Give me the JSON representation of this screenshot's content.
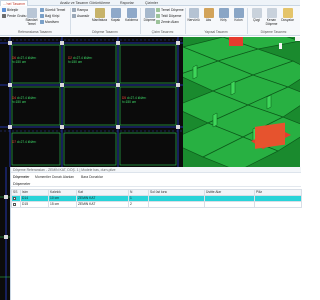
{
  "ribbon": {
    "tabs": [
      "...'nel Tasarım",
      "Analiz ve Tasarım Görüntüleme",
      "Raporlar",
      "Çizimler"
    ],
    "item_labels": [
      "Birleştir",
      "Perde Grubu",
      "Standart Temel",
      "Sürekli Temel",
      "Bağ Kirişi",
      "Mardiven",
      "Rampa",
      "Asansör",
      "Manifatura",
      "Kapak",
      "Kaldırma",
      "Döşeme",
      "Temel Döşeme",
      "Tekil Döşeme",
      "Zemin Alanı",
      "Nervürlü",
      "Aks",
      "Kiriş",
      "Kolon",
      "Çizgi",
      "Kenarı Döşeme",
      "Dosyalar",
      "Referansmane Bağlantı"
    ],
    "group_labels": [
      "Referanslama Tasarımı",
      "Döşeme Tasarımı",
      "Çizim Tasarımı",
      "Yapısal Tasarım",
      "Döşeme Tasarımı"
    ]
  },
  "plan": {
    "tags": [
      {
        "id": "D6",
        "line1": "d=27.4 kN/m²",
        "line2": "h=150 cm",
        "line3": "Ld=4.2"
      },
      {
        "id": "D2",
        "line1": "d=27.4 kN/m²",
        "line2": "h=150 cm",
        "line3": "Ld=4.2"
      },
      {
        "id": "D4",
        "line1": "d=27.4 kN/m²",
        "line2": "h=150 cm",
        "line3": ""
      },
      {
        "id": "D5",
        "line1": "d=27.4 kN/m²",
        "line2": "h=150 cm",
        "line3": ""
      },
      {
        "id": "D7",
        "line1": "d=27.4 kN/m²",
        "line2": "",
        "line3": ""
      }
    ]
  },
  "panel": {
    "title": "Döşeme Referansları - ZEMİN KAT, DÖŞ. 1 | Modele bas, durn-pilze",
    "tabs": [
      "Döşemeler",
      "Momentler Donatı Alanları",
      "Bara Donatılar"
    ],
    "subhead": "Döşemeler",
    "columns": [
      "SS",
      "İsim",
      "Kalınlık",
      "Kat",
      "N",
      "Sol üst kırsı",
      "Üsttte Alar",
      "Piliz"
    ],
    "rows": [
      {
        "selected": true,
        "ss": "",
        "name": "D14",
        "thickness": "10 cm",
        "floor": "ZEMİN KAT",
        "n": "1",
        "c1": "",
        "c2": "",
        "c3": ""
      },
      {
        "selected": false,
        "ss": "",
        "name": "D15",
        "thickness": "15 cm",
        "floor": "ZEMİN KAT",
        "n": "2",
        "c1": "",
        "c2": "",
        "c3": ""
      }
    ]
  },
  "colors": {
    "accent_red": "#c0392b",
    "selection": "#27d3d8",
    "plan_bg": "#0b0b0b",
    "plan_grid": "#2a3fd6",
    "tag_green": "#3fe06a",
    "view3d_green": "#1a8a2e",
    "highlight_red": "#e63b2e"
  }
}
